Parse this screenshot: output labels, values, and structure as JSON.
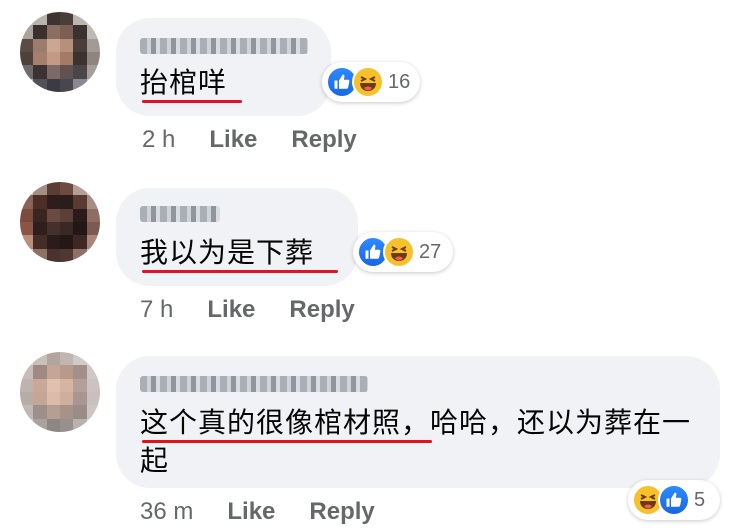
{
  "comments": [
    {
      "text": "抬棺咩",
      "reaction_count": "16",
      "reactions": [
        "like-icon",
        "haha-icon"
      ],
      "time": "2 h",
      "like_label": "Like",
      "reply_label": "Reply"
    },
    {
      "text": "我以为是下葬",
      "reaction_count": "27",
      "reactions": [
        "like-icon",
        "haha-icon"
      ],
      "time": "7 h",
      "like_label": "Like",
      "reply_label": "Reply"
    },
    {
      "text": "这个真的很像棺材照，哈哈，还以为葬在一起",
      "reaction_count": "5",
      "reactions": [
        "haha-icon",
        "like-icon"
      ],
      "time": "36 m",
      "like_label": "Like",
      "reply_label": "Reply"
    }
  ],
  "colors": {
    "bubble": "#f0f2f5",
    "underline": "#e0141e",
    "like_blue": "#1877f2",
    "haha_yellow": "#f7c12c",
    "meta_gray": "#65676b"
  }
}
